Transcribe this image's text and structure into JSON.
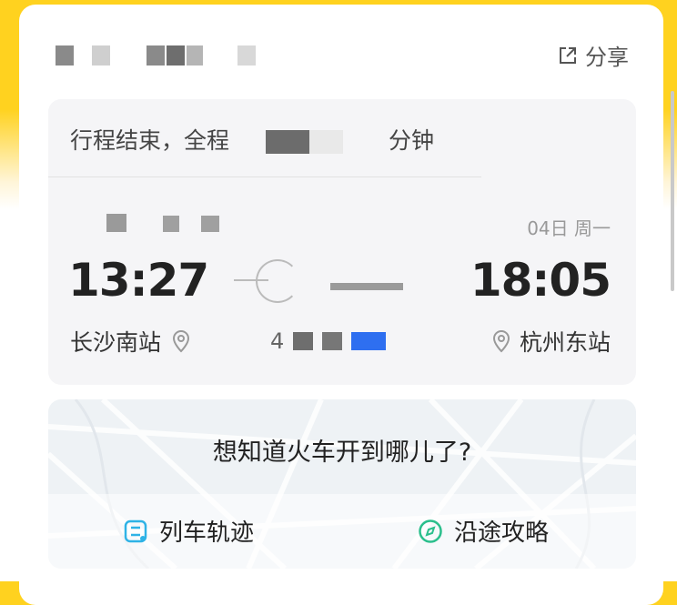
{
  "header": {
    "share_label": "分享"
  },
  "trip": {
    "status_prefix": "行程结束，全程",
    "status_suffix": "分钟",
    "date_right": "04日 周一",
    "depart_time": "13:27",
    "arrive_time": "18:05",
    "depart_station": "长沙南站",
    "arrive_station": "杭州东站",
    "train_no_prefix": "4"
  },
  "tracker": {
    "question": "想知道火车开到哪儿了?",
    "track_label": "列车轨迹",
    "guide_label": "沿途攻略"
  },
  "colors": {
    "brand_yellow": "#ffd21f",
    "track_icon": "#2fb3e6",
    "guide_icon": "#2bbf8c"
  }
}
